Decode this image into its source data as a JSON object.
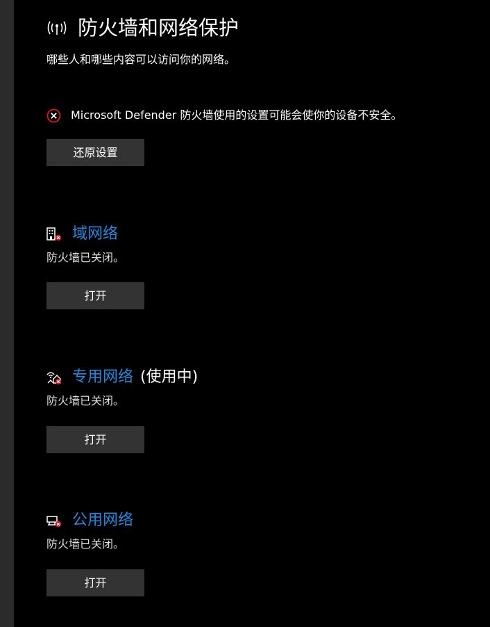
{
  "header": {
    "icon": "wireless-signal-icon",
    "title": "防火墙和网络保护",
    "subtitle": "哪些人和哪些内容可以访问你的网络。"
  },
  "warning": {
    "icon": "error-circle-x-icon",
    "text": "Microsoft Defender 防火墙使用的设置可能会使你的设备不安全。",
    "button_label": "还原设置"
  },
  "networks": [
    {
      "icon": "domain-network-icon",
      "title": "域网络",
      "suffix": "",
      "status": "防火墙已关闭。",
      "button_label": "打开"
    },
    {
      "icon": "private-network-icon",
      "title": "专用网络",
      "suffix": "(使用中)",
      "status": "防火墙已关闭。",
      "button_label": "打开"
    },
    {
      "icon": "public-network-icon",
      "title": "公用网络",
      "suffix": "",
      "status": "防火墙已关闭。",
      "button_label": "打开"
    }
  ],
  "colors": {
    "background": "#000000",
    "accent_link": "#1e8be3",
    "button_bg": "#333333",
    "error_red": "#e81123"
  }
}
